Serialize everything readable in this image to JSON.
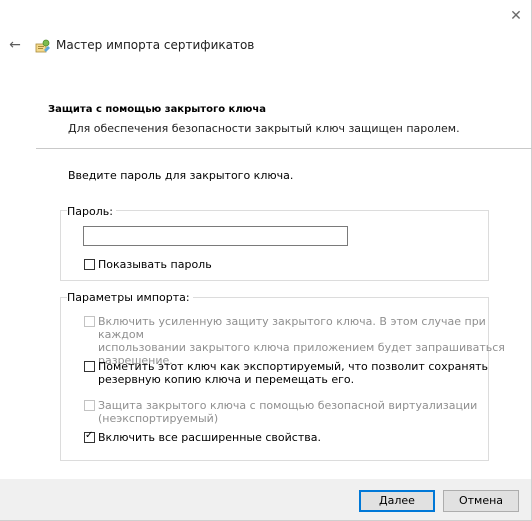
{
  "window": {
    "title": "Мастер импорта сертификатов"
  },
  "page": {
    "heading": "Защита с помощью закрытого ключа",
    "description": "Для обеспечения безопасности закрытый ключ защищен паролем.",
    "prompt": "Введите пароль для закрытого ключа."
  },
  "password_group": {
    "label": "Пароль:",
    "value": "",
    "show_password_label": "Показывать пароль",
    "show_password_checked": false
  },
  "import_options": {
    "label": "Параметры импорта:",
    "items": [
      {
        "line1": "Включить усиленную защиту закрытого ключа. В этом случае при каждом",
        "line2": "использовании закрытого ключа приложением будет запрашиваться",
        "line3": "разрешение.",
        "checked": false,
        "enabled": false
      },
      {
        "line1": "Пометить этот ключ как экспортируемый, что позволит сохранять",
        "line2": "резервную копию ключа и перемещать его.",
        "line3": "",
        "checked": false,
        "enabled": true
      },
      {
        "line1": "Защита закрытого ключа с помощью безопасной виртуализации",
        "line2": "(неэкспортируемый)",
        "line3": "",
        "checked": false,
        "enabled": false
      },
      {
        "line1": "Включить все расширенные свойства.",
        "line2": "",
        "line3": "",
        "checked": true,
        "enabled": true
      }
    ]
  },
  "buttons": {
    "next": "Далее",
    "cancel": "Отмена"
  },
  "icons": {
    "close": "close-icon",
    "back": "back-arrow-icon",
    "wizard": "certificate-wizard-icon"
  },
  "colors": {
    "accent": "#0078d7",
    "footer_bg": "#f0f0f0",
    "disabled_text": "#8f8f8f"
  }
}
